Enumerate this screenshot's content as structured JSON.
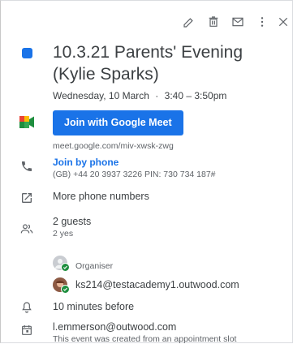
{
  "event": {
    "title": "10.3.21 Parents' Evening (Kylie Sparks)",
    "date": "Wednesday, 10 March",
    "separator": "·",
    "time": "3:40 – 3:50pm",
    "calendar_color": "#1a73e8"
  },
  "meet": {
    "button_label": "Join with Google Meet",
    "link": "meet.google.com/miv-xwsk-zwg"
  },
  "phone": {
    "label": "Join by phone",
    "details": "(GB) +44 20 3937 3226 PIN: 730 734 187#"
  },
  "more_numbers": "More phone numbers",
  "guests": {
    "summary": "2 guests",
    "status": "2 yes",
    "list": [
      {
        "name": "",
        "role": "Organiser"
      },
      {
        "name": "ks214@testacademy1.outwood.com",
        "role": ""
      }
    ]
  },
  "reminder": "10 minutes before",
  "organizer": {
    "email": "l.emmerson@outwood.com",
    "note": "This event was created from an appointment slot"
  },
  "icons": [
    "edit-icon",
    "trash-icon",
    "email-icon",
    "more-vert-icon",
    "close-icon",
    "meet-icon",
    "phone-icon",
    "external-link-icon",
    "people-icon",
    "bell-icon",
    "calendar-icon"
  ]
}
